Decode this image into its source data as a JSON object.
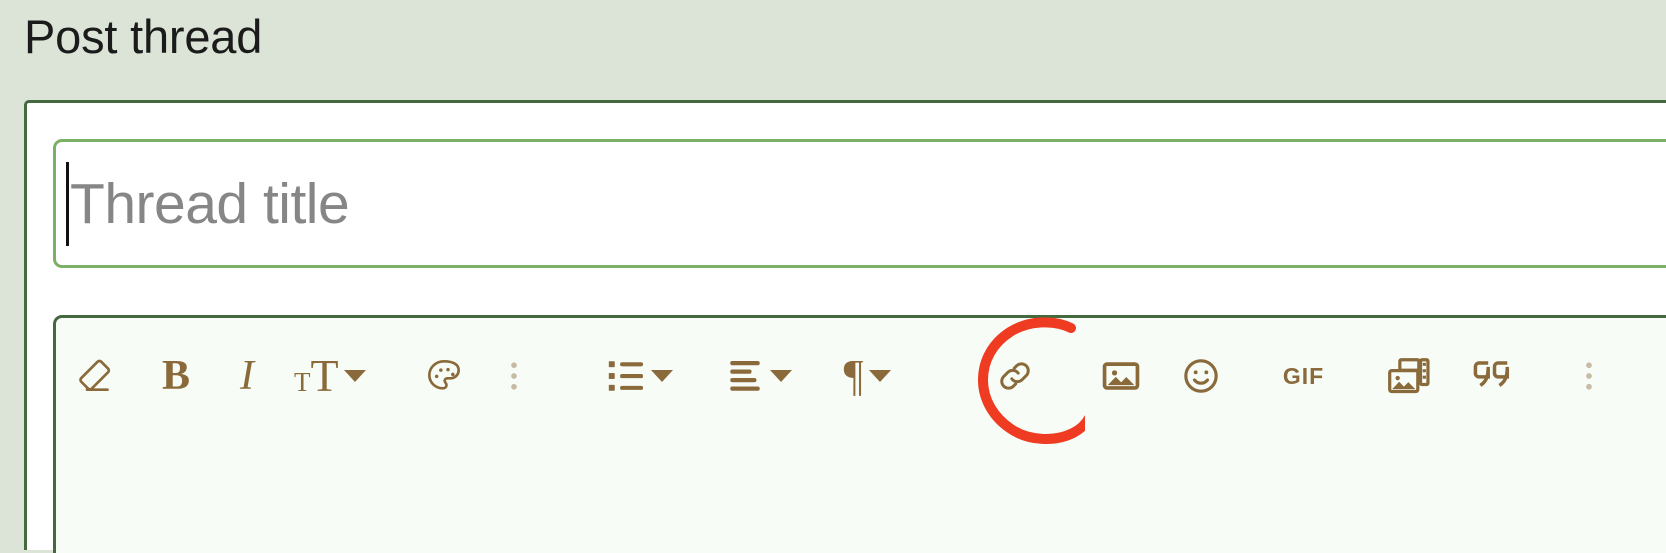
{
  "page": {
    "title": "Post thread",
    "background_color": "#dbe4d6",
    "card_background": "#ffffff",
    "card_border_color": "#44693e"
  },
  "title_field": {
    "value": "",
    "placeholder": "Thread title",
    "border_color": "#7cb069",
    "placeholder_color": "#868686",
    "caret_visible": "true"
  },
  "editor": {
    "border_color": "#44693e",
    "background_color": "#f7fdf6",
    "icon_color": "#8a6a3a",
    "muted_icon_color": "#c7bba6",
    "toolbar": [
      {
        "name": "remove-format-icon",
        "label": "Remove formatting",
        "icon": "eraser-icon",
        "dropdown": "false"
      },
      {
        "name": "bold-button",
        "label": "B",
        "icon": "bold-icon",
        "dropdown": "false"
      },
      {
        "name": "italic-button",
        "label": "I",
        "icon": "italic-icon",
        "dropdown": "false"
      },
      {
        "name": "font-size-button",
        "label": "Font size",
        "icon": "font-size-icon",
        "dropdown": "true"
      },
      {
        "name": "text-color-button",
        "label": "Text color",
        "icon": "palette-icon",
        "dropdown": "false"
      },
      {
        "name": "more-text-options-button",
        "label": "More text options",
        "icon": "vertical-dots-icon",
        "dropdown": "false"
      },
      {
        "name": "list-button",
        "label": "List",
        "icon": "bullet-list-icon",
        "dropdown": "true"
      },
      {
        "name": "align-button",
        "label": "Text alignment",
        "icon": "align-left-icon",
        "dropdown": "true"
      },
      {
        "name": "paragraph-format-button",
        "label": "Paragraph format",
        "icon": "pilcrow-icon",
        "dropdown": "true"
      },
      {
        "name": "insert-link-button",
        "label": "Insert link",
        "icon": "link-icon",
        "dropdown": "false"
      },
      {
        "name": "insert-image-button",
        "label": "Insert image",
        "icon": "image-icon",
        "dropdown": "false"
      },
      {
        "name": "insert-emoji-button",
        "label": "Insert emoji",
        "icon": "smiley-icon",
        "dropdown": "false"
      },
      {
        "name": "insert-gif-button",
        "label": "GIF",
        "icon": "gif-icon",
        "dropdown": "false"
      },
      {
        "name": "insert-media-button",
        "label": "Insert media",
        "icon": "media-gallery-icon",
        "dropdown": "false"
      },
      {
        "name": "insert-quote-button",
        "label": "Insert quote",
        "icon": "quote-icon",
        "dropdown": "false"
      },
      {
        "name": "more-options-button",
        "label": "More options",
        "icon": "vertical-dots-icon",
        "dropdown": "false"
      }
    ],
    "content": ""
  },
  "annotation": {
    "type": "hand-drawn-circle",
    "target": "insert-image-button",
    "color": "#ee3b22",
    "stroke_width": 10
  }
}
